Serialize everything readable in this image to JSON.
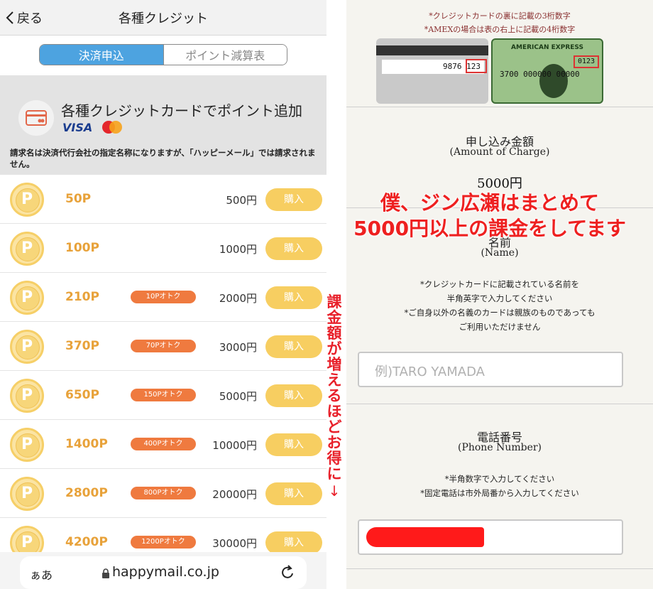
{
  "left": {
    "nav": {
      "back_label": "戻る",
      "title": "各種クレジット"
    },
    "segments": [
      {
        "label": "決済申込",
        "active": true
      },
      {
        "label": "ポイント減算表",
        "active": false
      }
    ],
    "info": {
      "title": "各種クレジットカードでポイント追加",
      "visa_label": "VISA",
      "mastercard_label": "MasterCard",
      "note": "請求名は決済代行会社の指定名称になりますが、「ハッピーメール」では請求されません。"
    },
    "coin_letter": "P",
    "buy_label": "購入",
    "packages": [
      {
        "points": "50P",
        "bonus": "",
        "price": "500円"
      },
      {
        "points": "100P",
        "bonus": "",
        "price": "1000円"
      },
      {
        "points": "210P",
        "bonus": "10Pオトク",
        "price": "2000円"
      },
      {
        "points": "370P",
        "bonus": "70Pオトク",
        "price": "3000円"
      },
      {
        "points": "650P",
        "bonus": "150Pオトク",
        "price": "5000円"
      },
      {
        "points": "1400P",
        "bonus": "400Pオトク",
        "price": "10000円"
      },
      {
        "points": "2800P",
        "bonus": "800Pオトク",
        "price": "20000円"
      },
      {
        "points": "4200P",
        "bonus": "1200Pオトク",
        "price": "30000円"
      }
    ],
    "browser": {
      "aa_label": "ぁあ",
      "url": "happymail.co.jp"
    }
  },
  "annotation_vertical": [
    "課",
    "金",
    "額",
    "が",
    "増",
    "え",
    "る",
    "ほ",
    "ど",
    "お",
    "得",
    "に",
    "↓"
  ],
  "annotation_overlay": [
    "僕、ジン広瀬はまとめて",
    "5000円以上の課金をしてます"
  ],
  "right": {
    "cvv_note_1": "*クレジットカードの裏に記載の3桁数字",
    "cvv_note_2": "*AMEXの場合は表の右上に記載の4桁数字",
    "card_back": {
      "number": "9876",
      "cvv": "123"
    },
    "card_amex": {
      "brand": "AMERICAN EXPRESS",
      "cid": "0123",
      "number": "3700  000000  00000"
    },
    "charge": {
      "title": "申し込み金額",
      "subtitle": "(Amount of Charge)",
      "value": "5000円"
    },
    "name": {
      "title": "名前",
      "subtitle": "(Name)",
      "notes": [
        "*クレジットカードに記載されている名前を",
        "半角英字で入力してください",
        "*ご自身以外の名義のカードは親族のものであっても",
        "ご利用いただけません"
      ],
      "placeholder": "例)TARO YAMADA"
    },
    "phone": {
      "title": "電話番号",
      "subtitle": "(Phone Number)",
      "notes": [
        "*半角数字で入力してください",
        "*固定電話は市外局番から入力してください"
      ]
    }
  },
  "colors": {
    "accent_blue": "#4da3e0",
    "coin_gold": "#f6cf67",
    "bonus_orange": "#ef7a3f",
    "annotation_red": "#ee2020"
  }
}
